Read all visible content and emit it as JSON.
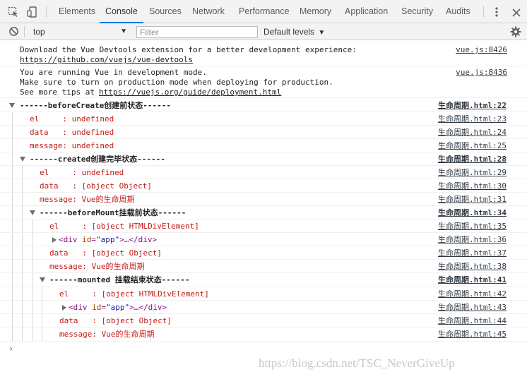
{
  "tabs": [
    "Elements",
    "Console",
    "Sources",
    "Network",
    "Performance",
    "Memory",
    "Application",
    "Security",
    "Audits"
  ],
  "active_tab": "Console",
  "toolbar": {
    "context": "top",
    "filter_placeholder": "Filter",
    "levels": "Default levels"
  },
  "messages": {
    "devtools": {
      "line1": "Download the Vue Devtools extension for a better development experience:",
      "link": "https://github.com/vuejs/vue-devtools",
      "src": "vue.js:8426"
    },
    "devmode": {
      "line1": "You are running Vue in development mode.",
      "line2": "Make sure to turn on production mode when deploying for production.",
      "line3_prefix": "See more tips at ",
      "link": "https://vuejs.org/guide/deployment.html",
      "src": "vue.js:8436"
    }
  },
  "groups": {
    "beforeCreate": {
      "title": "------beforeCreate创建前状态------",
      "src": "生命周期.html:22",
      "el": "el     : undefined",
      "el_src": "生命周期.html:23",
      "data": "data   : undefined",
      "data_src": "生命周期.html:24",
      "message": "message: undefined",
      "message_src": "生命周期.html:25"
    },
    "created": {
      "title": "------created创建完毕状态------",
      "src": "生命周期.html:28",
      "el": "el     : undefined",
      "el_src": "生命周期.html:29",
      "data": "data   : [object Object]",
      "data_src": "生命周期.html:30",
      "message": "message: Vue的生命周期",
      "message_src": "生命周期.html:31"
    },
    "beforeMount": {
      "title": "------beforeMount挂载前状态------",
      "src": "生命周期.html:34",
      "el": "el     : [object HTMLDivElement]",
      "el_src": "生命周期.html:35",
      "node_src": "生命周期.html:36",
      "data": "data   : [object Object]",
      "data_src": "生命周期.html:37",
      "message": "message: Vue的生命周期",
      "message_src": "生命周期.html:38"
    },
    "mounted": {
      "title": "------mounted 挂载结束状态------",
      "src": "生命周期.html:41",
      "el": "el     : [object HTMLDivElement]",
      "el_src": "生命周期.html:42",
      "node_src": "生命周期.html:43",
      "data": "data   : [object Object]",
      "data_src": "生命周期.html:44",
      "message": "message: Vue的生命周期",
      "message_src": "生命周期.html:45"
    }
  },
  "node": {
    "open": "<div",
    "attr": "id",
    "eq": "=",
    "val": "\"app\"",
    "mid": ">…</",
    "close_tag": "div",
    "end": ">"
  },
  "prompt": "›",
  "watermark": "https://blog.csdn.net/TSC_NeverGiveUp"
}
